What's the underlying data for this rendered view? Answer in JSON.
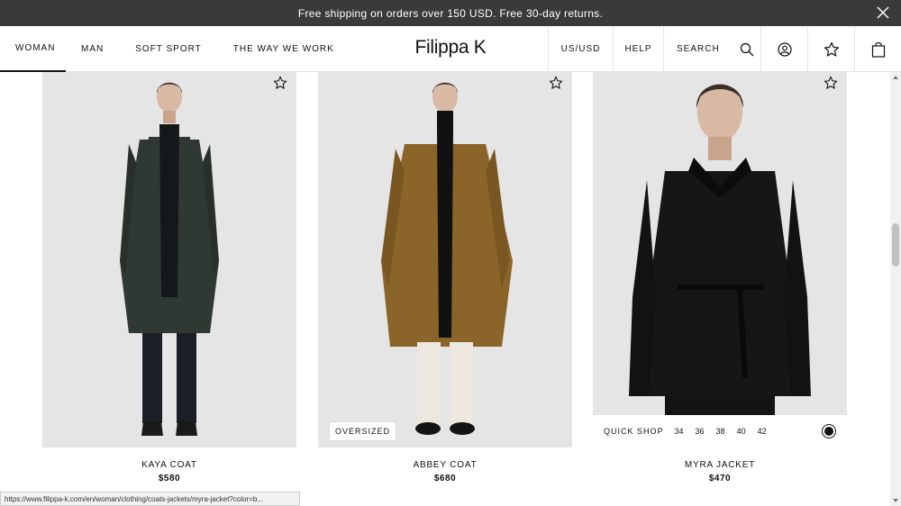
{
  "promo": {
    "text": "Free shipping on orders over 150 USD. Free 30-day returns."
  },
  "nav": {
    "links": [
      "WOMAN",
      "MAN",
      "SOFT SPORT",
      "THE WAY WE WORK"
    ],
    "active_link": "WOMAN",
    "logo": "Filippa K",
    "region": "US/USD",
    "help": "HELP",
    "search": "SEARCH"
  },
  "products": [
    {
      "name": "KAYA COAT",
      "price": "$580",
      "coat_color": "#2f3833"
    },
    {
      "name": "ABBEY COAT",
      "price": "$680",
      "badge": "OVERSIZED",
      "coat_color": "#8a6428"
    },
    {
      "name": "MYRA JACKET",
      "price": "$470",
      "coat_color": "#161616"
    }
  ],
  "quickshop": {
    "label": "QUICK SHOP",
    "sizes": [
      "34",
      "36",
      "38",
      "40",
      "42"
    ]
  },
  "statusbar": {
    "url": "https://www.filippa-k.com/en/woman/clothing/coats-jackets/myra-jacket?color=b..."
  },
  "colors": {
    "promo_bg": "#3a3a3a",
    "photo_bg": "#e5e5e5"
  }
}
